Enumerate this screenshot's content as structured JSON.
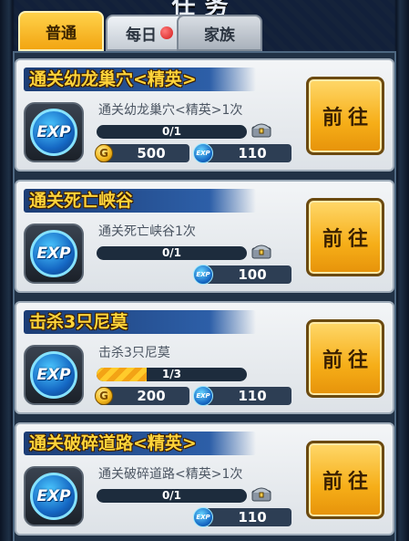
{
  "header": {
    "title": "任务"
  },
  "tabs": [
    {
      "label": "普通",
      "active": true
    },
    {
      "label": "每日",
      "has_alert": true
    },
    {
      "label": "家族"
    }
  ],
  "colors": {
    "accent": "#f6ae18",
    "title_text": "#ffd43a",
    "panel": "#213246"
  },
  "tasks": [
    {
      "title": "通关幼龙巢穴<精英>",
      "description": "通关幼龙巢穴<精英>1次",
      "progress_text": "0/1",
      "progress": 0,
      "gold": "500",
      "exp": "110",
      "button": "前往"
    },
    {
      "title": "通关死亡峡谷",
      "description": "通关死亡峡谷1次",
      "progress_text": "0/1",
      "progress": 0,
      "exp": "100",
      "button": "前往"
    },
    {
      "title": "击杀3只尼莫",
      "description": "击杀3只尼莫",
      "progress_text": "1/3",
      "progress": 0.333,
      "gold": "200",
      "exp": "110",
      "button": "前往"
    },
    {
      "title": "通关破碎道路<精英>",
      "description": "通关破碎道路<精英>1次",
      "progress_text": "0/1",
      "progress": 0,
      "exp": "110",
      "button": "前往"
    }
  ],
  "icons": {
    "task_icon": "EXP",
    "coin_icon": "coin-icon",
    "exp_icon": "EXP",
    "chest_icon": "chest-icon"
  }
}
